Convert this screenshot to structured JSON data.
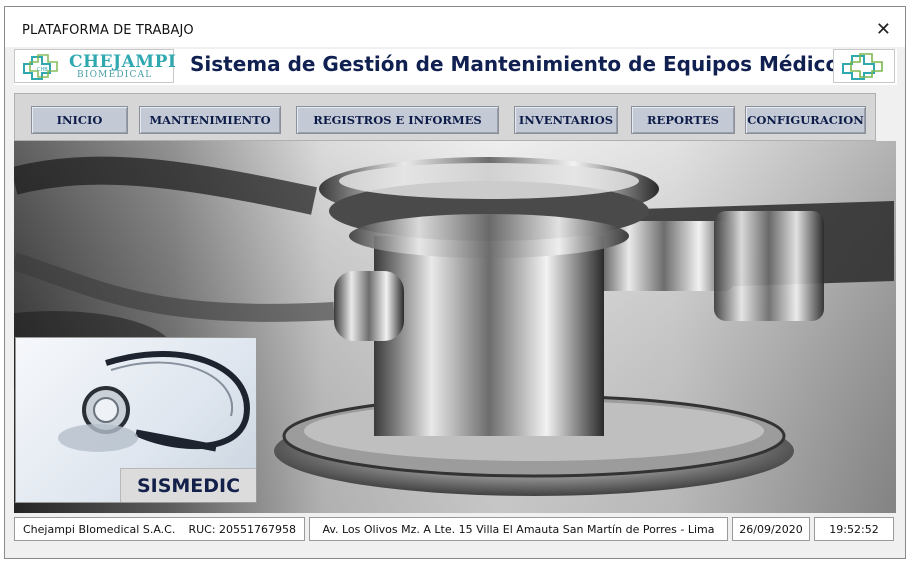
{
  "window": {
    "title": "PLATAFORMA DE TRABAJO",
    "close_glyph": "✕"
  },
  "banner": {
    "logo_left": {
      "brand": "CHEJAMPI",
      "sub": "BIOMEDICAL",
      "icon": "medical-cross-logo-icon"
    },
    "title": "Sistema de Gestión de Mantenimiento de Equipos Médicos",
    "logo_right": {
      "icon": "medical-cross-logo-icon"
    }
  },
  "menu": {
    "items": [
      {
        "label": "INICIO"
      },
      {
        "label": "MANTENIMIENTO"
      },
      {
        "label": "REGISTROS E INFORMES"
      },
      {
        "label": "INVENTARIOS"
      },
      {
        "label": "REPORTES"
      },
      {
        "label": "CONFIGURACION"
      }
    ]
  },
  "hero": {
    "image": "stethoscope-photo"
  },
  "card": {
    "label": "SISMEDIC",
    "image": "stethoscope-icon"
  },
  "status": {
    "company": "Chejampi BIomedical S.A.C.",
    "ruc": "RUC: 20551767958",
    "address": "Av. Los Olivos Mz. A Lte. 15 Villa El Amauta San Martín de Porres - Lima",
    "date": "26/09/2020",
    "time": "19:52:52"
  },
  "colors": {
    "accent": "#2fa8b0",
    "title": "#102050",
    "button": "#c3cad6"
  }
}
